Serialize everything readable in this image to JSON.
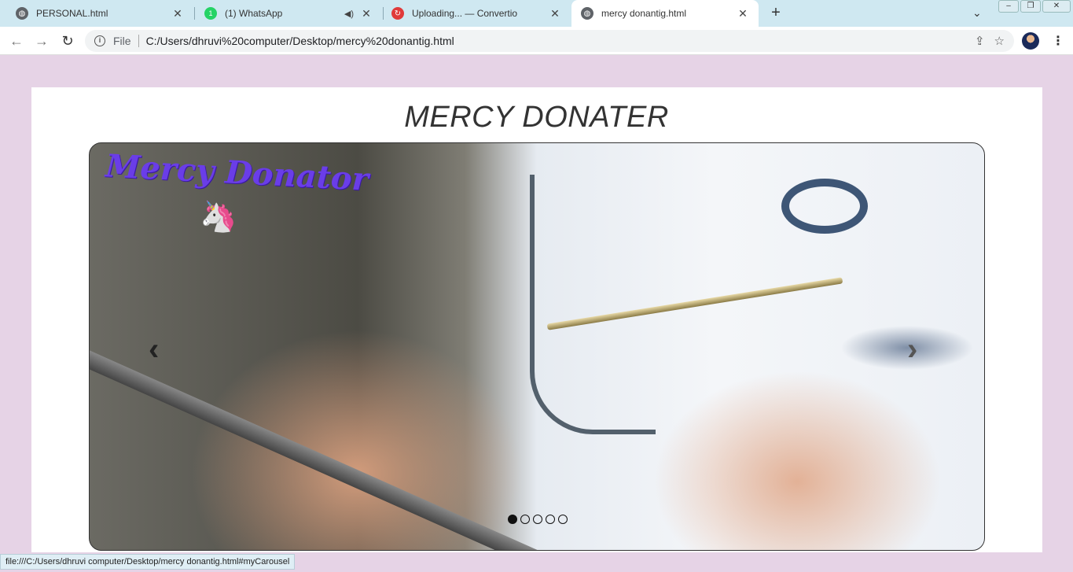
{
  "browser": {
    "tabs": [
      {
        "label": "PERSONAL.html",
        "icon": "globe-icon"
      },
      {
        "label": "(1) WhatsApp",
        "icon": "whatsapp-icon"
      },
      {
        "label": "Uploading... — Convertio",
        "icon": "convertio-icon"
      },
      {
        "label": "mercy donantig.html",
        "icon": "globe-icon",
        "active": true
      }
    ],
    "omnibox": {
      "scheme": "File",
      "url": "C:/Users/dhruvi%20computer/Desktop/mercy%20donantig.html"
    },
    "status_url": "file:///C:/Users/dhruvi computer/Desktop/mercy donantig.html#myCarousel"
  },
  "page": {
    "heading": "MERCY DONATER",
    "carousel": {
      "brand": "Mercy Donator",
      "slide_count": 5,
      "active_slide": 1
    }
  },
  "colors": {
    "page_bg": "#e6d3e6",
    "brand_text": "#6a3de8",
    "tabstrip": "#cfe8f1"
  }
}
